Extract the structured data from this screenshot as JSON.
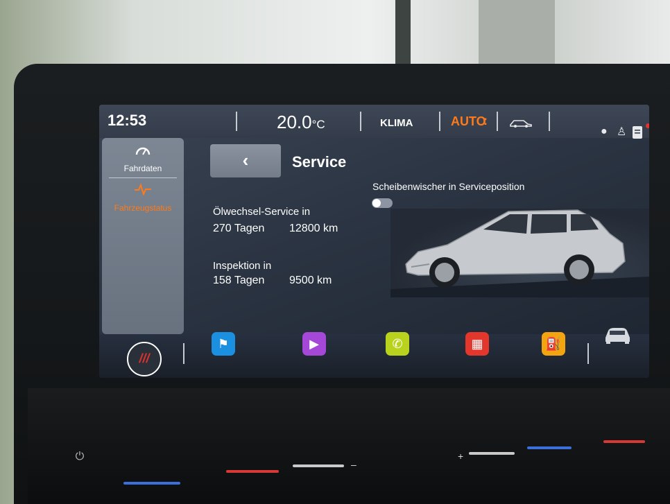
{
  "status_bar": {
    "time": "12:53",
    "temperature_value": "20.0",
    "temperature_unit": "°C",
    "klima_label": "KLIMA",
    "auto_label": "AUTO",
    "auto_menu": ":"
  },
  "sidebar": {
    "items": [
      {
        "label": "Fahrdaten",
        "icon": "speedometer-icon",
        "active": false
      },
      {
        "label": "Fahrzeugstatus",
        "icon": "pulse-icon",
        "active": true
      }
    ]
  },
  "page": {
    "back_glyph": "‹",
    "title": "Service",
    "wiper_label": "Scheibenwischer in Serviceposition",
    "wiper_toggle_on": false
  },
  "service": {
    "oil": {
      "label": "Ölwechsel-Service in",
      "days": "270 Tagen",
      "km": "12800 km"
    },
    "inspection": {
      "label": "Inspektion in",
      "days": "158 Tagen",
      "km": "9500 km"
    }
  },
  "dock": {
    "seat_button": "///",
    "apps": [
      {
        "name": "navigation",
        "color": "#1b8fe0",
        "glyph": "⚑"
      },
      {
        "name": "media",
        "color": "#a548d8",
        "glyph": "▶"
      },
      {
        "name": "phone",
        "color": "#b9d21e",
        "glyph": "✆"
      },
      {
        "name": "apps",
        "color": "#e3362d",
        "glyph": "▦"
      },
      {
        "name": "fuel",
        "color": "#f2a511",
        "glyph": "⛽"
      }
    ]
  },
  "colors": {
    "accent": "#ff7a1a",
    "text": "#ffffff",
    "seat_red": "#e0312c"
  }
}
